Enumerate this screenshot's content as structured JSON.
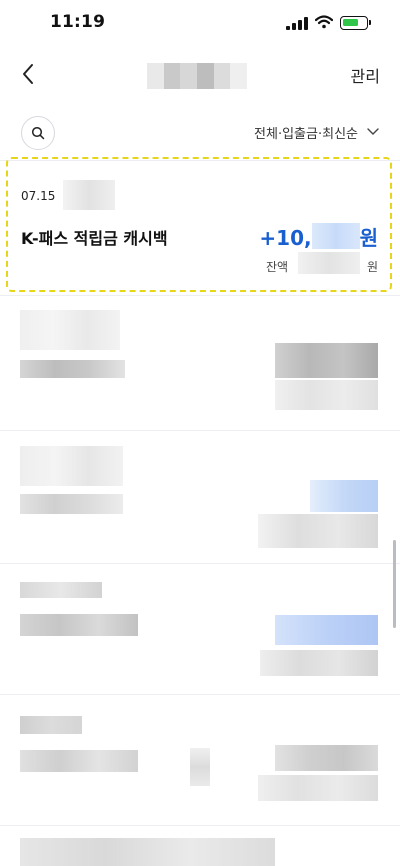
{
  "status_bar": {
    "time": "11:19"
  },
  "header": {
    "manage_label": "관리"
  },
  "filter": {
    "label": "전체·입출금·최신순"
  },
  "highlighted_tx": {
    "date": "07.15",
    "title": "K-패스 적립금 캐시백",
    "amount_prefix": "+10,",
    "amount_unit": "원",
    "balance_label": "잔액",
    "balance_unit": "원"
  },
  "icons": {
    "back": "chevron-left-icon",
    "search": "search-icon",
    "filter": "chevron-down-icon",
    "wifi": "wifi-icon",
    "battery": "battery-charging-icon",
    "signal": "cellular-signal-icon"
  },
  "colors": {
    "amount_blue": "#1a5fd0",
    "highlight_yellow": "#e6d619",
    "battery_green": "#2fc64a"
  }
}
